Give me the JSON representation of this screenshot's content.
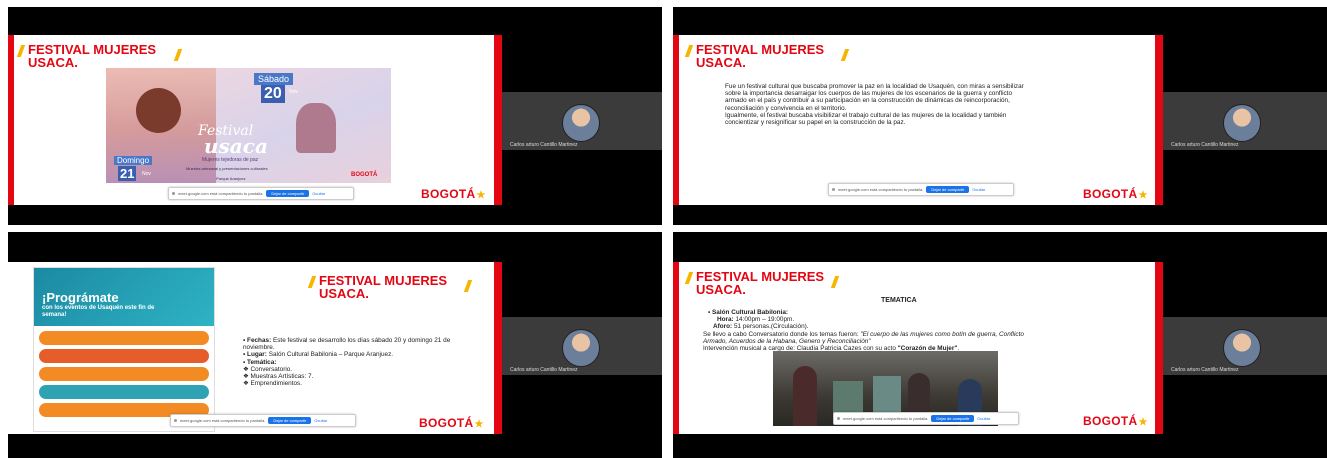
{
  "participant": {
    "name": "Carlos arturo Cantillo Martinez"
  },
  "share_bar": {
    "message": "meet.google.com está compartiendo tu pantalla.",
    "stop_label": "Dejar de compartir",
    "hide_label": "Ocultar"
  },
  "slides": {
    "title": "FESTIVAL MUJERES\nUSACA.",
    "logo": "BOGOTÁ",
    "slide1": {
      "poster_lines": [
        "Sábado",
        "20",
        "Nov",
        "Festival",
        "usaca",
        "Mujeres tejedoras de paz",
        "Domingo",
        "21",
        "Nov",
        "Muestra artesanal y presentaciones culturales",
        "Parque Aranjuez",
        "BOGOTÁ"
      ]
    },
    "slide2": {
      "paragraph": "Fue un festival cultural que buscaba promover la paz en la localidad de Usaquén, con miras a sensibilizar sobre la importancia desarraigar los cuerpos de las mujeres de los escenarios de la guerra y conflicto armado en el país y contribuir a su participación en la construcción de dinámicas de reincorporación, reconciliación y convivencia en el territorio.\nIgualmente, el festival buscaba visibilizar el trabajo cultural de las mujeres de la localidad y también concientizar y resignificar su papel en la construcción de la paz."
    },
    "slide3": {
      "program_title": "¡Prográmate",
      "program_sub": "con los eventos de Usaquén este fin de semana!",
      "bullets": [
        {
          "label": "Fechas:",
          "text": " Este festival se desarrollo los días sábado 20 y domingo 21 de noviembre."
        },
        {
          "label": "Lugar:",
          "text": " Salón Cultural Babilonia – Parque Aranjuez."
        },
        {
          "label": "Temática:",
          "text": ""
        }
      ],
      "sub_items": [
        "Conversatorio.",
        "Muestras Artísticas: 7.",
        "Emprendimientos."
      ]
    },
    "slide4": {
      "heading": "TEMATICA",
      "venue_label": "Salón Cultural Babilonia:",
      "hora_label": "Hora:",
      "hora_value": " 14:00pm – 19:00pm.",
      "aforo_label": "Aforo:",
      "aforo_value": " 51 personas.(Circulación).",
      "line1": "Se llevo a cabo Conversatorio donde los temas fueron: ",
      "line1_italic": "\"El cuerpo de las mujeres como botín de guerra, Conflicto Armado, Acuerdos de la Habana, Genero y Reconciliación\"",
      "line2": " Intervención musical a cargo de: Claudia Patricia Cazes con su acto ",
      "line2_bold": "\"Corazón de Mujer\"",
      "line2_end": "."
    }
  },
  "colors": {
    "brand_red": "#e30613",
    "brand_yellow": "#f6b600",
    "share_blue": "#1a73e8"
  }
}
